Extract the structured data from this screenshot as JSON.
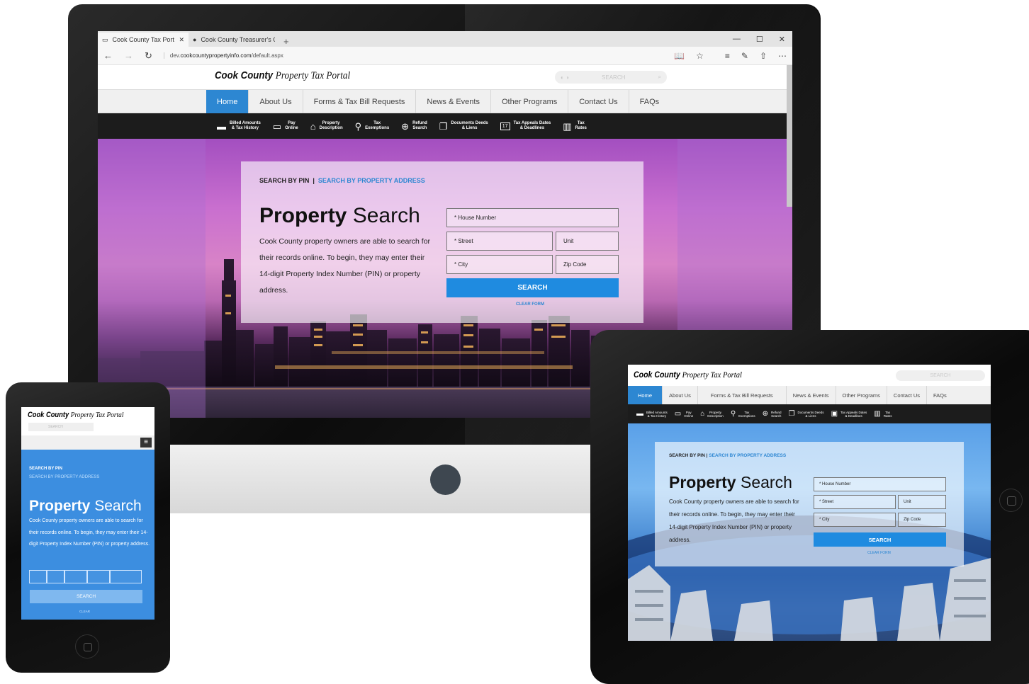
{
  "browser": {
    "tabs": [
      {
        "title": "Cook County Tax Portal",
        "active": true
      },
      {
        "title": "Cook County Treasurer's Offi",
        "active": false
      }
    ],
    "new_tab": "+",
    "url_prefix": "dev.",
    "url_domain": "cookcountypropertyinfo.com",
    "url_path": "/default.aspx"
  },
  "site": {
    "logo_bold": "Cook County",
    "logo_rest": "Property Tax Portal",
    "search_placeholder": "SEARCH",
    "nav": [
      "Home",
      "About Us",
      "Forms & Tax Bill Requests",
      "News & Events",
      "Other Programs",
      "Contact Us",
      "FAQs"
    ],
    "subnav": [
      {
        "line1": "Billed Amounts",
        "line2": "& Tax History",
        "icon": "folder-icon"
      },
      {
        "line1": "Pay",
        "line2": "Online",
        "icon": "monitor-icon"
      },
      {
        "line1": "Property",
        "line2": "Description",
        "icon": "house-icon"
      },
      {
        "line1": "Tax",
        "line2": "Exemptions",
        "icon": "map-pin-icon"
      },
      {
        "line1": "Refund",
        "line2": "Search",
        "icon": "crosshair-icon"
      },
      {
        "line1": "Documents Deeds",
        "line2": "& Liens",
        "icon": "documents-icon"
      },
      {
        "line1": "Tax Appeals Dates",
        "line2": "& Deadlines",
        "icon": "calendar-icon"
      },
      {
        "line1": "Tax",
        "line2": "Rates",
        "icon": "bar-chart-icon"
      }
    ],
    "search_card": {
      "tab_pin": "SEARCH BY PIN",
      "tab_sep": "|",
      "tab_address": "SEARCH BY PROPERTY ADDRESS",
      "title_bold": "Property",
      "title_rest": "Search",
      "description": "Cook County property owners are able to search for their records online. To begin, they may enter their 14-digit Property Index Number (PIN) or property address.",
      "house_number": "* House Number",
      "street": "* Street",
      "unit": "Unit",
      "city": "* City",
      "zip": "Zip Code",
      "search_button": "SEARCH",
      "clear": "CLEAR FORM"
    },
    "calendar_glyph": "17"
  },
  "phone": {
    "tab_pin": "SEARCH BY PIN",
    "tab_address": "SEARCH BY PROPERTY ADDRESS",
    "search_button": "SEARCH",
    "clear": "CLEAR",
    "menu_glyph": "≡"
  },
  "tablet": {
    "clear": "CLEAR FORM"
  }
}
